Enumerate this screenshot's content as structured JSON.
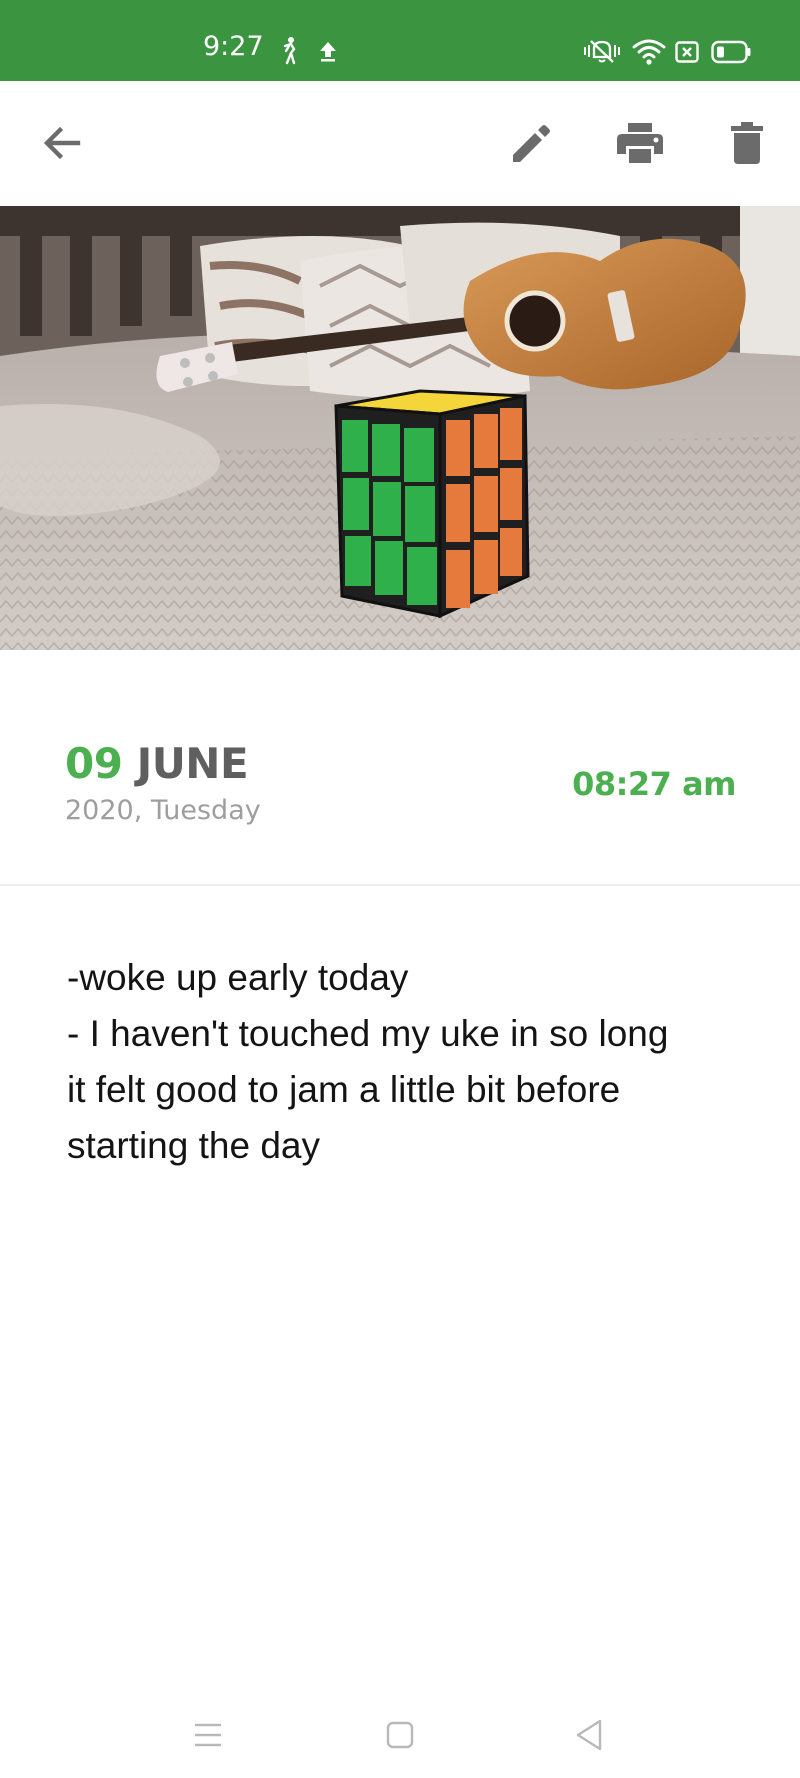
{
  "status_bar": {
    "time": "9:27",
    "background_color": "#3a9440",
    "left_icons": [
      "activity-person-icon",
      "upload-arrow-icon"
    ],
    "right_icons": [
      "vibrate-silent-icon",
      "wifi-icon",
      "screen-cast-icon",
      "battery-icon"
    ]
  },
  "toolbar": {
    "back_icon": "arrow-left-icon",
    "actions": [
      "pencil-edit-icon",
      "printer-icon",
      "trash-icon"
    ],
    "icon_color": "#6b6b6b"
  },
  "photo": {
    "subject": ""
  },
  "entry": {
    "day": "09",
    "month": "JUNE",
    "year_weekday": "2020, Tuesday",
    "time": "08:27 am",
    "accent_color": "#4caf50",
    "lines": [
      "-woke up early today",
      "- I haven't touched my uke in so long",
      "it felt good to jam a little bit before",
      "starting the day"
    ]
  },
  "nav_bar": {
    "buttons": [
      "menu-lines-icon",
      "home-square-icon",
      "back-triangle-icon"
    ]
  }
}
